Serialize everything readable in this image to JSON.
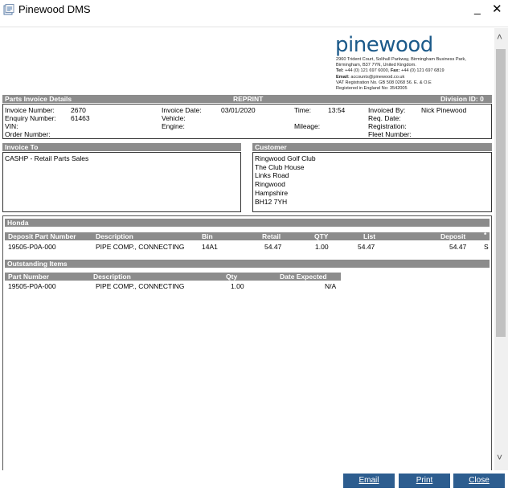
{
  "window": {
    "title": "Pinewood DMS",
    "minimize": "_",
    "close": "✕"
  },
  "logo": {
    "text": "pinewood"
  },
  "address": {
    "line1": "2960 Trident Court, Solihull Parkway, Birmingham Business Park,",
    "line2": "Birmingham, B37 7YN, United Kingdom.",
    "tel_label": "Tel:",
    "tel": "+44 (0) 121 697 6000,",
    "fax_label": "Fax:",
    "fax": "+44 (0) 121 697 6819",
    "email_label": "Email:",
    "email": "accounts@pinewood.co.uk",
    "vat": "VAT Registration No. GB 508 0268 56. E. & O.E",
    "registered": "Registered in England No: 3542005"
  },
  "details": {
    "header": "Parts Invoice Details",
    "reprint": "REPRINT",
    "division": "Division ID: 0",
    "invoice_number_label": "Invoice Number:",
    "invoice_number": "2670",
    "enquiry_number_label": "Enquiry Number:",
    "enquiry_number": "61463",
    "vin_label": "VIN:",
    "order_number_label": "Order Number:",
    "invoice_date_label": "Invoice Date:",
    "invoice_date": "03/01/2020",
    "vehicle_label": "Vehicle:",
    "engine_label": "Engine:",
    "time_label": "Time:",
    "time": "13:54",
    "mileage_label": "Mileage:",
    "invoiced_by_label": "Invoiced By:",
    "invoiced_by": "Nick Pinewood",
    "req_date_label": "Req. Date:",
    "registration_label": "Registration:",
    "fleet_number_label": "Fleet Number:"
  },
  "invoice_to": {
    "header": "Invoice To",
    "lines": [
      "CASHP - Retail Parts Sales"
    ]
  },
  "customer": {
    "header": "Customer",
    "lines": [
      "Ringwood Golf Club",
      "The Club House",
      "Links Road",
      "Ringwood",
      "Hampshire",
      "BH12 7YH"
    ]
  },
  "parts": {
    "section": "Honda",
    "columns": [
      "Deposit Part Number",
      "Description",
      "Bin",
      "Retail",
      "QTY",
      "List",
      "Deposit",
      "*"
    ],
    "rows": [
      [
        "19505-P0A-000",
        "PIPE COMP., CONNECTING",
        "14A1",
        "54.47",
        "1.00",
        "54.47",
        "54.47",
        "S"
      ]
    ]
  },
  "outstanding": {
    "section": "Outstanding Items",
    "columns": [
      "Part Number",
      "Description",
      "Qty",
      "Date Expected"
    ],
    "rows": [
      [
        "19505-P0A-000",
        "PIPE COMP., CONNECTING",
        "1.00",
        "N/A"
      ]
    ]
  },
  "buttons": {
    "email": "Email",
    "print": "Print",
    "close": "Close"
  },
  "colors": {
    "brand": "#1c5a8a",
    "button": "#2d5d8f",
    "bar": "#8c8c8c"
  },
  "icons": {
    "app": "pinewood-app-icon",
    "scroll_up": "chevron-up-icon",
    "scroll_down": "chevron-down-icon"
  }
}
